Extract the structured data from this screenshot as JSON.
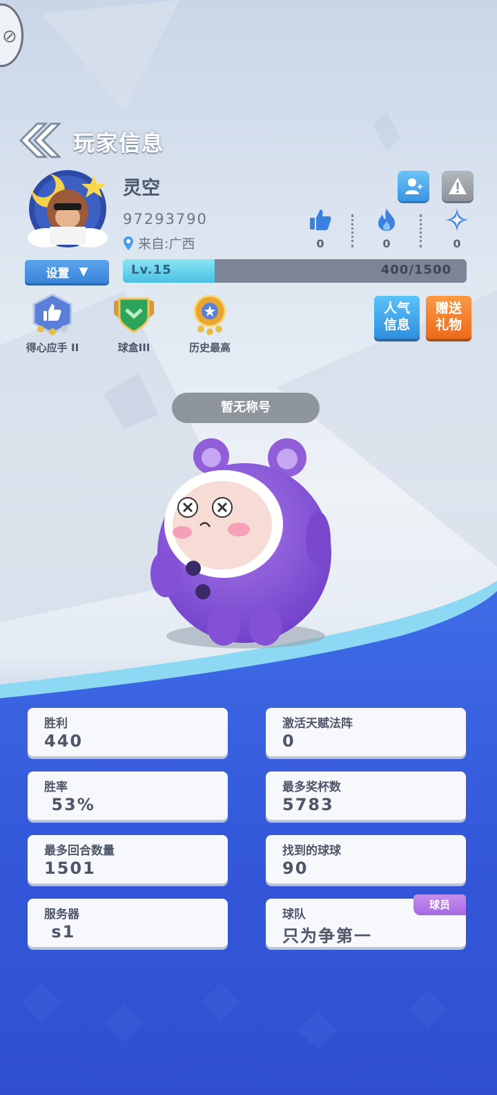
{
  "header": {
    "title": "玩家信息"
  },
  "player": {
    "name": "灵空",
    "uid": "97293790",
    "from_label": "来自:广西"
  },
  "stats": {
    "likes": "0",
    "hot": "0",
    "stars": "0"
  },
  "settings": {
    "label": "设置"
  },
  "level": {
    "label": "Lv.15",
    "progress_text": "400/1500",
    "current": 400,
    "max": 1500
  },
  "badges": [
    {
      "label": "得心应手 II",
      "icon": "thumbs-up-medal-icon"
    },
    {
      "label": "球盒III",
      "icon": "green-shield-icon"
    },
    {
      "label": "历史最高",
      "icon": "gold-medal-icon"
    }
  ],
  "actions": {
    "popularity": "人气信息",
    "popularity_line1": "人气",
    "popularity_line2": "信息",
    "gift_line1": "赠送",
    "gift_line2": "礼物"
  },
  "title_pill": "暂无称号",
  "cards": [
    {
      "label": "胜利",
      "value": "440"
    },
    {
      "label": "激活天赋法阵",
      "value": "0"
    },
    {
      "label": "胜率",
      "value": " 53%"
    },
    {
      "label": "最多奖杯数",
      "value": "5783"
    },
    {
      "label": "最多回合数量",
      "value": "1501"
    },
    {
      "label": "找到的球球",
      "value": "90"
    },
    {
      "label": "服务器",
      "value": " s1"
    },
    {
      "label": "球队",
      "value": "只为争第一",
      "tag": "球员"
    }
  ],
  "colors": {
    "accent_blue": "#3b83d8",
    "wave_blue": "#3355d8",
    "gift_orange": "#ec6a1c",
    "tag_purple": "#a569e0"
  }
}
